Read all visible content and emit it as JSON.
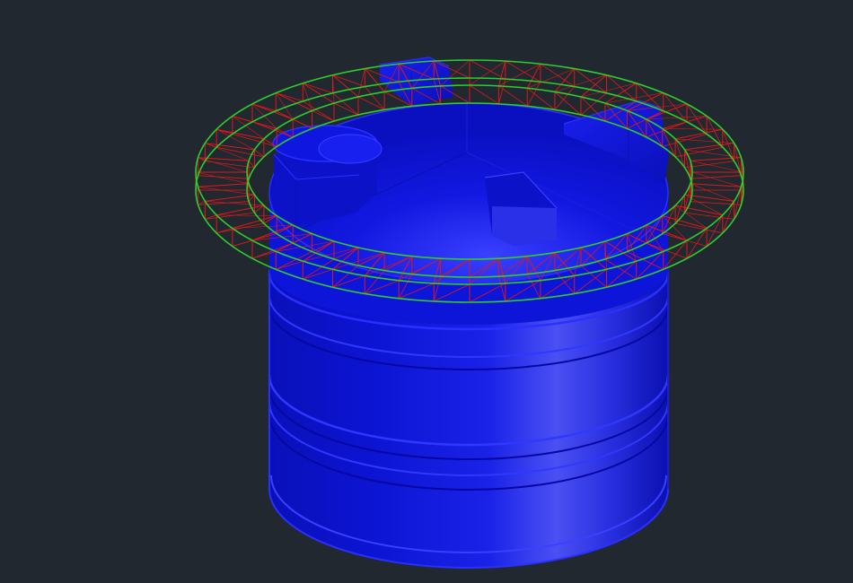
{
  "viewport": {
    "background": "#212830"
  },
  "model": {
    "tank_body_color": "#0b14d6",
    "tank_highlight_color": "#5a60ff",
    "tank_shadow_color": "#060a8a",
    "tank_edge_color": "#2a30ff",
    "ring_chord_color": "#2ecc2e",
    "ring_web_color": "#e01818"
  }
}
